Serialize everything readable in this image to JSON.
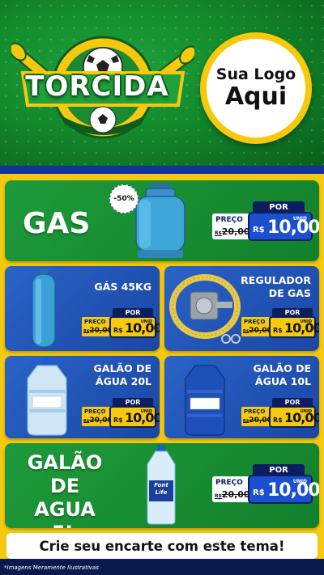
{
  "header": {
    "emblem_text": "TORCIDA",
    "logo_line1": "Sua Logo",
    "logo_line2": "Aqui"
  },
  "discount_badge": "-50%",
  "price_common": {
    "preco_label": "PREÇO",
    "por_label": "POR",
    "unid_label": "UNID",
    "old_currency": "R$",
    "old_value": "20,00",
    "currency": "R$",
    "new_value": "10,00"
  },
  "products": {
    "gas": {
      "title": "GAS"
    },
    "gas45": {
      "title_line1": "GÁS 45KG"
    },
    "regulador": {
      "title_line1": "REGULADOR",
      "title_line2": "DE GAS"
    },
    "galao20": {
      "title_line1": "GALÃO DE",
      "title_line2": "ÁGUA 20L"
    },
    "galao10": {
      "title_line1": "GALÃO DE",
      "title_line2": "ÁGUA 10L"
    },
    "galao5": {
      "title_line1": "GALÃO",
      "title_line2": "DE AGUA",
      "title_line3": "5L",
      "bottle_brand_line1": "Font",
      "bottle_brand_line2": "Life"
    }
  },
  "cta_text": "Crie seu encarte com este tema!",
  "footer_note": "*Imagens Meramente Ilustrativas",
  "colors": {
    "green": "#1e9a3a",
    "blue": "#1a4fcf",
    "yellow": "#f6c90e",
    "navy": "#0c1e5e"
  }
}
